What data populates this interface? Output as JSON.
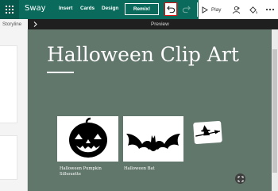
{
  "app": {
    "name": "Sway"
  },
  "toolbar": {
    "menu": [
      "Insert",
      "Cards",
      "Design"
    ],
    "remix_label": "Remix!",
    "play_label": "Play"
  },
  "subbar": {
    "storyline_label": "Storyline",
    "preview_label": "Preview"
  },
  "preview": {
    "title": "Halloween Clip Art",
    "items": [
      {
        "caption": "Halloween Pumpkin Silhouette"
      },
      {
        "caption": "Halloween Bat"
      }
    ]
  },
  "colors": {
    "brand": "#0a6a5c",
    "stage": "#62776c",
    "highlight": "#e01010"
  }
}
